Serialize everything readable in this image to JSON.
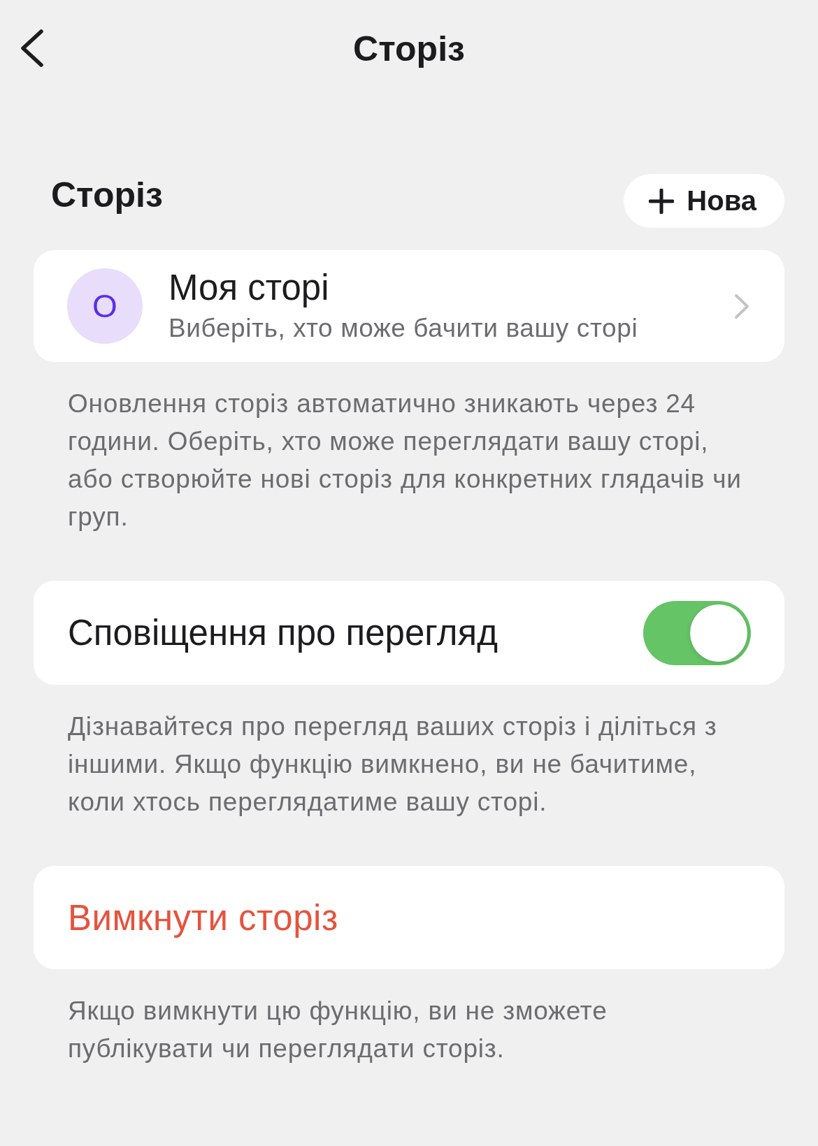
{
  "header": {
    "title": "Сторіз"
  },
  "section": {
    "title": "Сторіз",
    "new_button": {
      "label": "Нова"
    }
  },
  "story_card": {
    "avatar_letter": "О",
    "title": "Моя сторі",
    "subtitle": "Виберіть, хто може бачити вашу сторі"
  },
  "story_note": "Оновлення сторіз автоматично зникають через 24 години. Оберіть, хто може переглядати вашу сторі, або створюйте нові сторіз для конкретних глядачів чи груп.",
  "view_notifications": {
    "label": "Сповіщення про перегляд",
    "on": true
  },
  "view_note": "Дізнавайтеся про перегляд ваших сторіз і діліться з іншими. Якщо функцію вимкнено, ви не бачитиме, коли хтось переглядатиме вашу сторі.",
  "disable_stories": {
    "label": "Вимкнути сторіз"
  },
  "disable_note": "Якщо вимкнути цю функцію, ви не зможете публікувати чи переглядати сторіз."
}
